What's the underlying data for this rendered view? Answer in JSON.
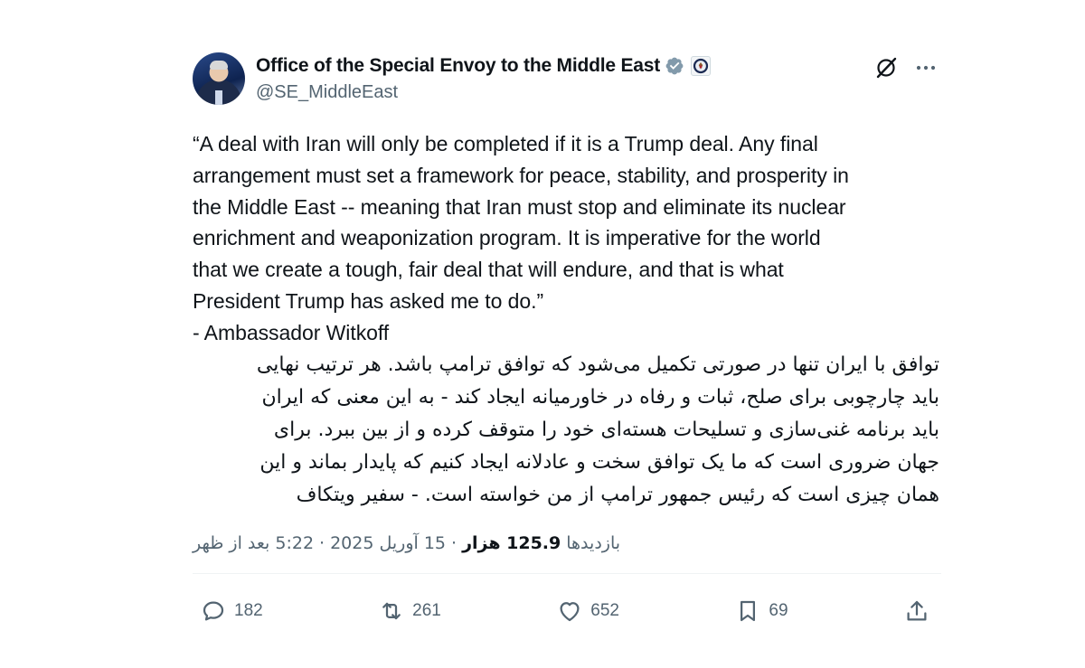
{
  "author": {
    "display_name": "Office of the Special Envoy to the Middle East",
    "handle": "@SE_MiddleEast",
    "verified_icon": "verified-badge-icon",
    "affiliation_icon": "us-state-department-seal-icon",
    "avatar_icon": "avatar"
  },
  "tweet": {
    "text_en": "“A deal with Iran will only be completed if it is a Trump deal. Any final\narrangement must set a framework for peace, stability, and prosperity in\nthe Middle East -- meaning that Iran must stop and eliminate its nuclear\nenrichment and weaponization program. It is imperative for the world\nthat we create a tough, fair deal that will endure, and that is what\nPresident Trump has asked me to do.”\n- Ambassador Witkoff",
    "text_fa": "توافق با ایران تنها در صورتی تکمیل می‌شود که توافق ترامپ باشد. هر ترتیب نهایی\nباید چارچوبی برای صلح، ثبات و رفاه در خاورمیانه ایجاد کند - به این معنی که ایران\nباید برنامه غنی‌سازی و تسلیحات هسته‌ای خود را متوقف کرده و از بین ببرد. برای\nجهان ضروری است که ما یک توافق سخت و عادلانه ایجاد کنیم که پایدار بماند و این\nهمان چیزی است که رئیس جمهور ترامپ از من خواسته است. - سفیر ویتکاف"
  },
  "meta": {
    "time": "5:22 بعد از ظهر",
    "date": "15 آوریل 2025",
    "separator": "·",
    "views_count": "125.9 هزار",
    "views_label": "بازدیدها"
  },
  "actions": {
    "reply_count": "182",
    "retweet_count": "261",
    "like_count": "652",
    "bookmark_count": "69"
  },
  "colors": {
    "text": "#0f1419",
    "secondary": "#536471",
    "verified": "#829aab",
    "divider": "#eff3f4"
  }
}
